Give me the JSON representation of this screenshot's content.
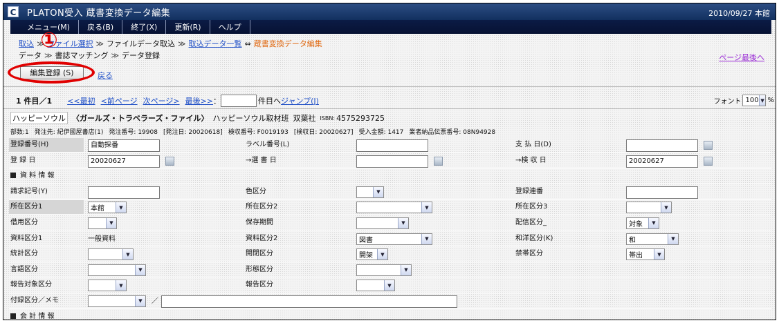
{
  "window": {
    "title": "PLATON受入 蔵書変換データ編集",
    "date_branch": "2010/09/27 本館",
    "logo": "C"
  },
  "menu": [
    "メニュー(M)",
    "戻る(B)",
    "終了(X)",
    "更新(R)",
    "ヘルプ"
  ],
  "breadcrumb1": {
    "a": "取込",
    "b": "ファイル選択",
    "c": "ファイルデータ取込",
    "d": "取込データ一覧",
    "arrow": "⇔",
    "current": "蔵書変換データ編集",
    "sep": "≫"
  },
  "breadcrumb2": {
    "a": "データ",
    "b": "書誌マッチング",
    "c": "データ登録"
  },
  "page_bottom_link": "ページ最後へ",
  "annotation_number": "①",
  "edit_button": "編集登録 (S)",
  "back_link": "戻る",
  "pager": {
    "count": "1 件目／1",
    "first": "<<最初",
    "prev": "<前ページ",
    "next": "次ページ>",
    "last": "最後>>",
    "colon": "：",
    "jump_suffix": "件目へ",
    "jump": "ジャンプ(J)"
  },
  "font_ctl": {
    "label": "フォント",
    "value": "100",
    "unit": "%"
  },
  "book": {
    "publisher_tag": "ハッピーソウル",
    "title": "〈ガールズ・トラベラーズ・ファイル〉",
    "author": "ハッピーソウル取材班",
    "publisher": "双葉社",
    "isbn_label": "ISBN:",
    "isbn": "4575293725"
  },
  "order_info": [
    "部数:1",
    "発注先: 紀伊國屋書店(1)",
    "発注番号: 19908",
    "[発注日: 20020618]",
    "検収番号: F0019193",
    "[検収日: 20020627]",
    "受入金額: 1417",
    "業者納品伝票番号: 08N94928"
  ],
  "fields": {
    "reg_no": {
      "label": "登録番号(H)",
      "value": "自動採番"
    },
    "label_no": {
      "label": "ラベル番号(L)",
      "value": ""
    },
    "payment_date": {
      "label": "支 払 日(D)",
      "value": ""
    },
    "reg_date": {
      "label": "登 録 日",
      "value": "20020627"
    },
    "selection_date": {
      "label": "→選 書 日",
      "value": ""
    },
    "inspect_date": {
      "label": "→検 収 日",
      "value": "20020627"
    },
    "section_material": "資 料 情 報",
    "request_code": {
      "label": "請求記号(Y)",
      "value": ""
    },
    "color": {
      "label": "色区分",
      "value": ""
    },
    "reg_serial": {
      "label": "登録連番",
      "value": ""
    },
    "location1": {
      "label": "所在区分1",
      "value": "本館"
    },
    "location2": {
      "label": "所在区分2",
      "value": ""
    },
    "location3": {
      "label": "所在区分3",
      "value": ""
    },
    "loan": {
      "label": "借用区分",
      "value": ""
    },
    "retention": {
      "label": "保存期間",
      "value": ""
    },
    "distribution": {
      "label": "配信区分_",
      "value": "対象"
    },
    "material1": {
      "label": "資料区分1",
      "value": "一般資料"
    },
    "material2": {
      "label": "資料区分2",
      "value": "図書"
    },
    "lang_type": {
      "label": "和洋区分(K)",
      "value": "和"
    },
    "statistics": {
      "label": "統計区分",
      "value": ""
    },
    "open_close": {
      "label": "開閉区分",
      "value": "開架"
    },
    "prohibit": {
      "label": "禁帯区分",
      "value": "帯出"
    },
    "language": {
      "label": "言語区分",
      "value": ""
    },
    "form": {
      "label": "形態区分",
      "value": ""
    },
    "report_target": {
      "label": "報告対象区分",
      "value": ""
    },
    "report": {
      "label": "報告区分",
      "value": ""
    },
    "appendix": {
      "label": "付録区分／メモ",
      "value": "",
      "slash": "／",
      "memo": ""
    },
    "section_accounting": "会 計 情 報"
  }
}
